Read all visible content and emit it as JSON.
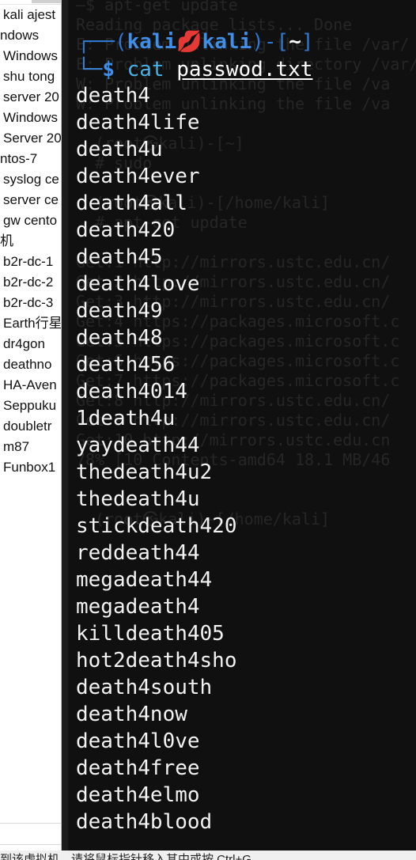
{
  "sidebar": {
    "items": [
      {
        "label": "kali ajest",
        "level": 1
      },
      {
        "label": "ndows",
        "level": 0
      },
      {
        "label": "Windows",
        "level": 1
      },
      {
        "label": "shu tong",
        "level": 1
      },
      {
        "label": "server 20",
        "level": 1
      },
      {
        "label": "Windows",
        "level": 1
      },
      {
        "label": "Server 20",
        "level": 1
      },
      {
        "label": "ntos-7",
        "level": 0
      },
      {
        "label": "syslog ce",
        "level": 1
      },
      {
        "label": "server ce",
        "level": 1
      },
      {
        "label": "gw cento",
        "level": 1
      },
      {
        "label": "机",
        "level": 0
      },
      {
        "label": "b2r-dc-1",
        "level": 1
      },
      {
        "label": "b2r-dc-2",
        "level": 1
      },
      {
        "label": "b2r-dc-3",
        "level": 1
      },
      {
        "label": "Earth行星",
        "level": 1
      },
      {
        "label": "dr4gon",
        "level": 1
      },
      {
        "label": "deathno",
        "level": 1
      },
      {
        "label": "HA-Aven",
        "level": 1
      },
      {
        "label": "Seppuku",
        "level": 1
      },
      {
        "label": "doubletr",
        "level": 1
      },
      {
        "label": "m87",
        "level": 1
      },
      {
        "label": "Funbox1",
        "level": 1
      }
    ]
  },
  "terminal": {
    "ghost_lines": [
      "—$ apt-get update",
      "Reading package lists... Done",
      "E: Problem unlinking the file /var/",
      "E: Problem unlinking directory /var/",
      "W: Problem unlinking the file /va",
      "W: Problem unlinking the file /va",
      "  (root㉿kali)-[~]",
      "  # sudo",
      "  (root㉿kali)-[/home/kali]",
      "  # apt-get update",
      "Get:1 http://mirrors.ustc.edu.cn/",
      "Get:2 http://mirrors.ustc.edu.cn/",
      "Get:3 http://mirrors.ustc.edu.cn/",
      "Get:4 https://packages.microsoft.c",
      "Get:5 https://packages.microsoft.c",
      "Get:6 https://packages.microsoft.c",
      "Get:7 https://packages.microsoft.c",
      "Get:8 http://mirrors.ustc.edu.cn/",
      "Get:9 http://mirrors.ustc.edu.cn/",
      "Get:10 http://mirrors.ustc.edu.cn",
      "78% [10 Contents-amd64 18.1 MB/46",
      "",
      "",
      "  (root㉿kali)-[/home/kali]"
    ],
    "prompt": {
      "open_paren": "┌──(",
      "user": "kali",
      "separator_icon": "💋",
      "host": "kali",
      "close_paren": ")-[",
      "dir": "~",
      "close_bracket": "]",
      "prefix2": "└─",
      "dollar": "$",
      "command": "cat",
      "argument": "passwod.txt"
    },
    "output": [
      "death4",
      "death4life",
      "death4u",
      "death4ever",
      "death4all",
      "death420",
      "death45",
      "death4love",
      "death49",
      "death48",
      "death456",
      "death4014",
      "1death4u",
      "yaydeath44",
      "thedeath4u2",
      "thedeath4u",
      "stickdeath420",
      "reddeath44",
      "megadeath44",
      "megadeath4",
      "killdeath405",
      "hot2death4sho",
      "death4south",
      "death4now",
      "death4l0ve",
      "death4free",
      "death4elmo",
      "death4blood"
    ]
  },
  "status": {
    "text": "到该虚拟机，请将鼠标指针移入其中或按 Ctrl+G。"
  },
  "colors": {
    "terminal_bg": "#101010",
    "prompt_blue": "#3f8ee8",
    "command_cyan": "#46b3e6",
    "output_text": "#f2f2f2",
    "lips_red": "#e0303a"
  }
}
